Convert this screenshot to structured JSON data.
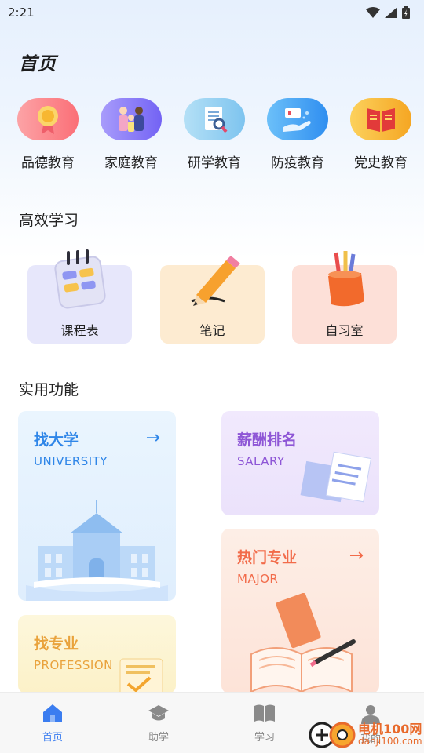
{
  "status_bar": {
    "time": "2:21"
  },
  "page": {
    "title": "首页"
  },
  "categories": [
    {
      "label": "品德教育",
      "icon": "medal-icon",
      "color": "#fb7b82"
    },
    {
      "label": "家庭教育",
      "icon": "family-icon",
      "color": "#8a7cf7"
    },
    {
      "label": "研学教育",
      "icon": "study-tour-icon",
      "color": "#7ec4ef"
    },
    {
      "label": "防疫教育",
      "icon": "epidemic-icon",
      "color": "#43a6f5"
    },
    {
      "label": "党史教育",
      "icon": "party-history-book-icon",
      "color": "#f7b92d"
    }
  ],
  "sections": {
    "efficient": "高效学习",
    "tools": "实用功能"
  },
  "study": [
    {
      "label": "课程表",
      "icon": "calendar-icon",
      "bg": "#e7e7fb"
    },
    {
      "label": "笔记",
      "icon": "pencil-icon",
      "bg": "#fdebd1"
    },
    {
      "label": "自习室",
      "icon": "pen-holder-icon",
      "bg": "#fde0d8"
    }
  ],
  "features": {
    "university": {
      "title": "找大学",
      "sub": "UNIVERSITY",
      "arrow": "→"
    },
    "salary": {
      "title": "薪酬排名",
      "sub": "SALARY"
    },
    "major": {
      "title": "热门专业",
      "sub": "MAJOR",
      "arrow": "→"
    },
    "profession": {
      "title": "找专业",
      "sub": "PROFESSION"
    }
  },
  "nav": [
    {
      "label": "首页",
      "icon": "home-icon",
      "active": true
    },
    {
      "label": "助学",
      "icon": "graduation-cap-icon",
      "active": false
    },
    {
      "label": "学习",
      "icon": "book-icon",
      "active": false
    },
    {
      "label": "我的",
      "icon": "user-icon",
      "active": false
    }
  ],
  "watermark": {
    "text": "电机100网",
    "url": "danji100.com"
  },
  "colors": {
    "accent": "#3b7df0",
    "university": "#2f86e8",
    "salary": "#8e56d6",
    "major": "#f26b4a",
    "profession": "#e9a23b"
  }
}
